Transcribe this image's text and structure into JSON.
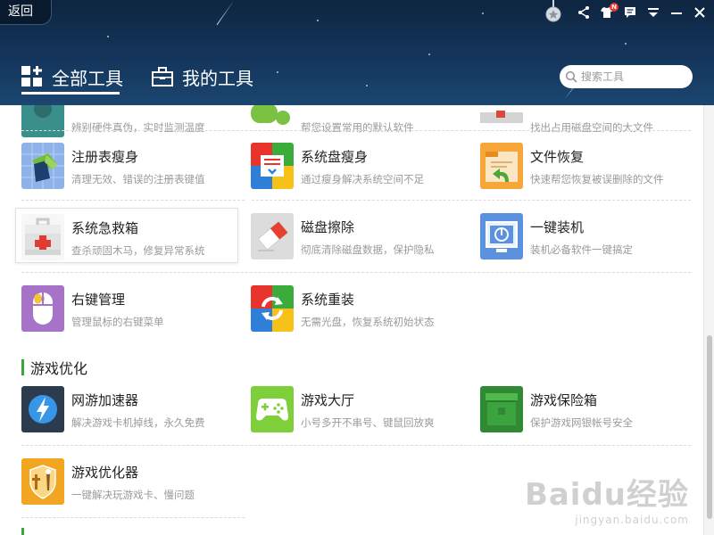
{
  "header": {
    "back_label": "返回",
    "tabs": [
      {
        "label": "全部工具",
        "active": true
      },
      {
        "label": "我的工具",
        "active": false
      }
    ],
    "search_placeholder": "搜索工具",
    "notification_badge": "N"
  },
  "partial_row": {
    "descs": [
      "辨别硬件真伪，实时监测温度",
      "帮您设置常用的默认软件",
      "找出占用磁盘空间的大文件"
    ]
  },
  "tools": [
    {
      "name": "注册表瘦身",
      "desc": "清理无效、错误的注册表键值",
      "icon": "registry-icon"
    },
    {
      "name": "系统盘瘦身",
      "desc": "通过瘦身解决系统空间不足",
      "icon": "system-disk-icon"
    },
    {
      "name": "文件恢复",
      "desc": "快速帮您恢复被误删除的文件",
      "icon": "file-recovery-icon"
    },
    {
      "name": "系统急救箱",
      "desc": "查杀顽固木马，修复异常系统",
      "icon": "first-aid-icon"
    },
    {
      "name": "磁盘擦除",
      "desc": "彻底清除磁盘数据，保护隐私",
      "icon": "eraser-icon"
    },
    {
      "name": "一键装机",
      "desc": "装机必备软件一键搞定",
      "icon": "monitor-icon"
    },
    {
      "name": "右键管理",
      "desc": "管理鼠标的右键菜单",
      "icon": "mouse-icon"
    },
    {
      "name": "系统重装",
      "desc": "无需光盘，恢复系统初始状态",
      "icon": "reinstall-icon"
    }
  ],
  "game_section": {
    "title": "游戏优化",
    "tools": [
      {
        "name": "网游加速器",
        "desc": "解决游戏卡机掉线，永久免费",
        "icon": "lightning-icon"
      },
      {
        "name": "游戏大厅",
        "desc": "小号多开不串号、键鼠回放爽",
        "icon": "gamepad-icon"
      },
      {
        "name": "游戏保险箱",
        "desc": "保护游戏网银帐号安全",
        "icon": "safe-box-icon"
      },
      {
        "name": "游戏优化器",
        "desc": "一键解决玩游戏卡、慢问题",
        "icon": "shield-sword-icon"
      }
    ]
  },
  "watermark": {
    "logo": "Baidu经验",
    "url": "jingyan.baidu.com"
  },
  "colors": {
    "header": "#14355b",
    "accent_green": "#3aa53a"
  }
}
